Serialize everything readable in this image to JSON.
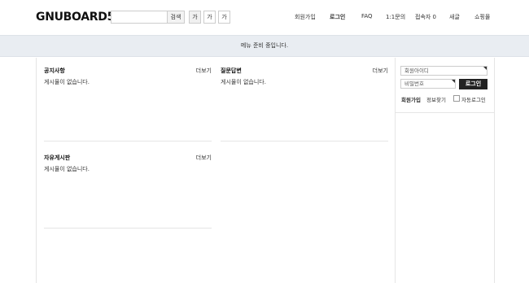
{
  "header": {
    "logo": "GNUBOARD5",
    "search": {
      "value": "",
      "button": "검색"
    },
    "font_buttons": [
      "가",
      "가",
      "가"
    ],
    "nav": [
      "회원가입",
      "로그인",
      "FAQ",
      "1:1문의",
      "접속자 0",
      "새글",
      "쇼핑몰"
    ]
  },
  "menu_bar": {
    "message": "메뉴 준비 중입니다."
  },
  "boards": [
    {
      "title": "공지사항",
      "more": "더보기",
      "empty": "게시물이 없습니다."
    },
    {
      "title": "질문답변",
      "more": "더보기",
      "empty": "게시물이 없습니다."
    },
    {
      "title": "자유게시판",
      "more": "더보기",
      "empty": "게시물이 없습니다."
    }
  ],
  "login": {
    "id_placeholder": "회원아이디",
    "pw_placeholder": "비밀번호",
    "login_button": "로그인",
    "join_link": "회원가입",
    "find_link": "정보찾기",
    "auto_login_label": "자동로그인"
  }
}
